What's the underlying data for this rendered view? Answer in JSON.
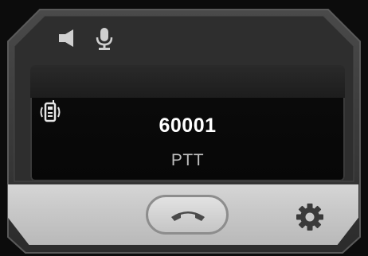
{
  "status_bar": {
    "speaker_icon": "speaker-icon",
    "mic_icon": "microphone-icon"
  },
  "screen": {
    "call_icon": "radio-walkie-talkie-icon",
    "number": "60001",
    "mode": "PTT"
  },
  "controls": {
    "end_call_icon": "hang-up-icon",
    "settings_icon": "gear-icon"
  },
  "colors": {
    "frame": "#3d3d3d",
    "screen_bg": "#0a0a0a",
    "bar": "#c8c8c8",
    "text": "#ffffff"
  }
}
